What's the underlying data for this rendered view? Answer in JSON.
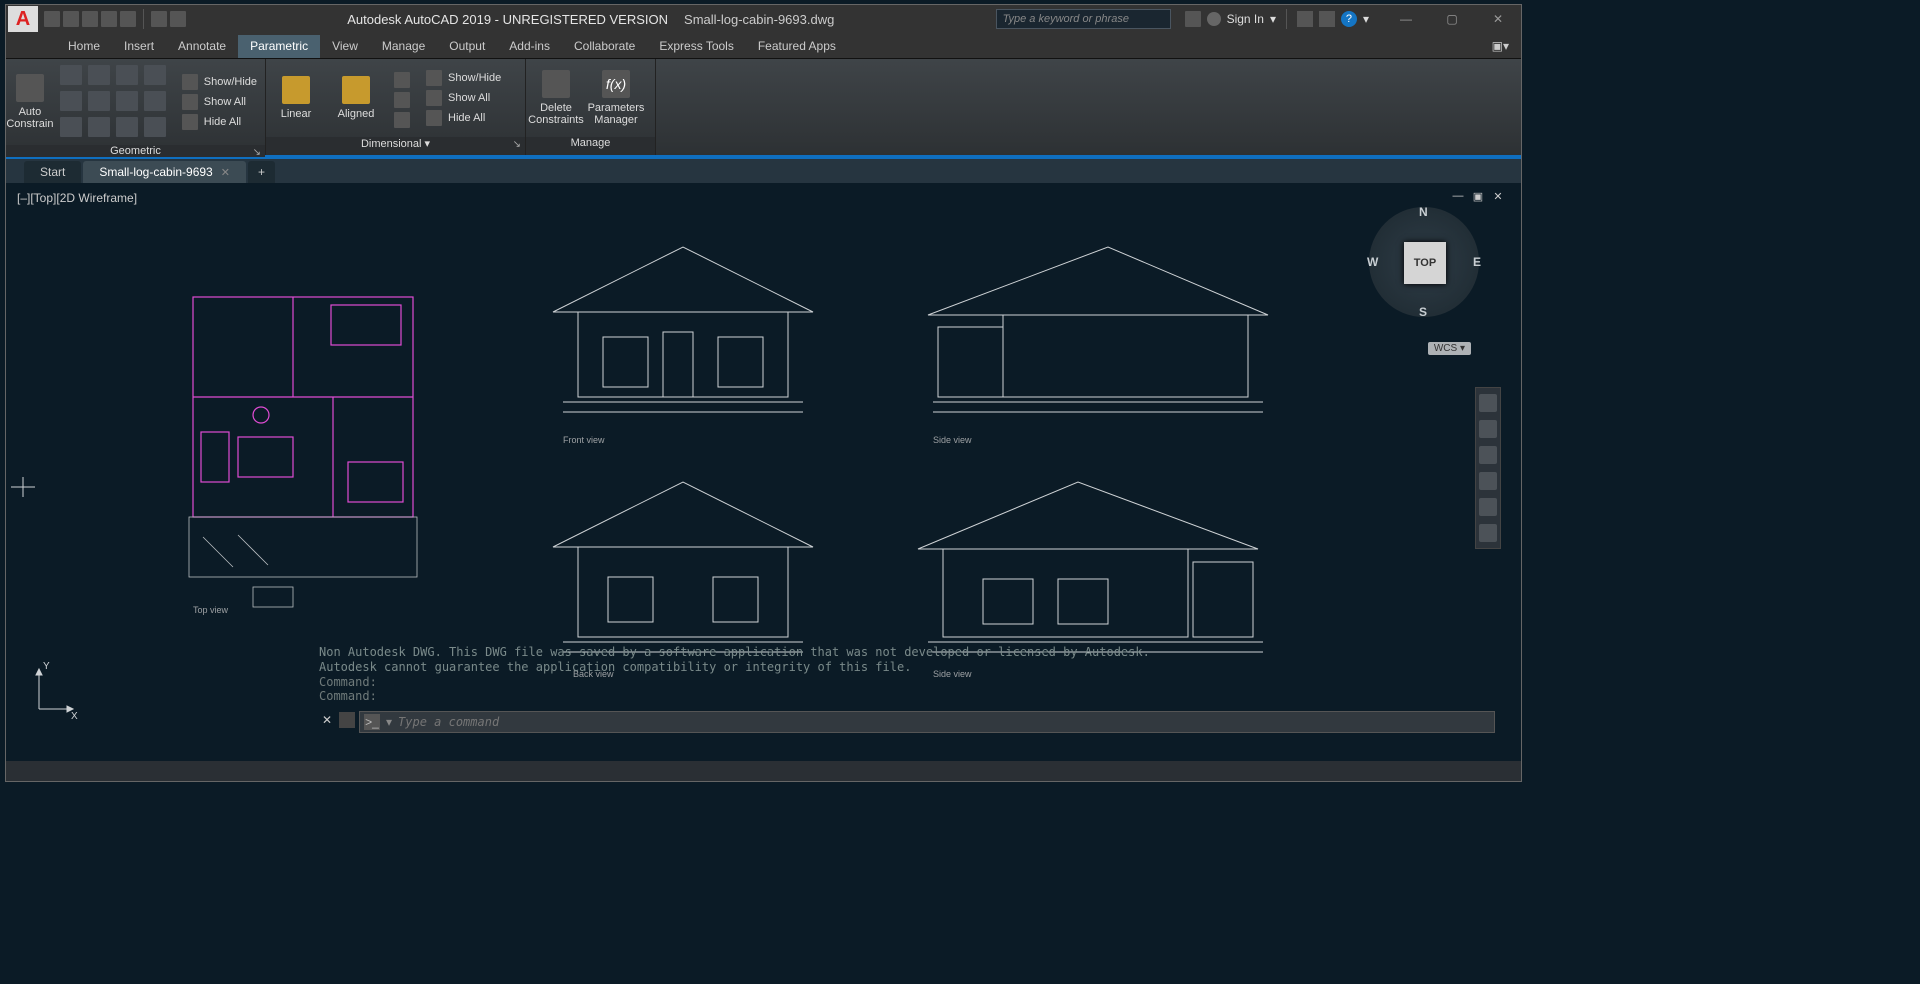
{
  "title": {
    "app": "Autodesk AutoCAD 2019 - UNREGISTERED VERSION",
    "file": "Small-log-cabin-9693.dwg"
  },
  "search": {
    "placeholder": "Type a keyword or phrase"
  },
  "signin": {
    "label": "Sign In"
  },
  "ribbon": {
    "tabs": [
      "Home",
      "Insert",
      "Annotate",
      "Parametric",
      "View",
      "Manage",
      "Output",
      "Add-ins",
      "Collaborate",
      "Express Tools",
      "Featured Apps"
    ],
    "active": "Parametric",
    "panels": {
      "geo": {
        "auto": "Auto\nConstrain",
        "items": [
          "Show/Hide",
          "Show All",
          "Hide All"
        ],
        "label": "Geometric"
      },
      "dim": {
        "linear": "Linear",
        "aligned": "Aligned",
        "items": [
          "Show/Hide",
          "Show All",
          "Hide All"
        ],
        "label": "Dimensional"
      },
      "mgr": {
        "del": "Delete\nConstraints",
        "param": "Parameters\nManager",
        "label": "Manage"
      }
    }
  },
  "filetabs": {
    "start": "Start",
    "doc": "Small-log-cabin-9693"
  },
  "viewport": {
    "label": "[–][Top][2D Wireframe]"
  },
  "viewcube": {
    "face": "TOP",
    "n": "N",
    "s": "S",
    "e": "E",
    "w": "W",
    "wcs": "WCS"
  },
  "drawings": {
    "plan": "Top view",
    "front": "Front view",
    "side1": "Side view",
    "back": "Back view",
    "side2": "Side view"
  },
  "cmd": {
    "msg1": "Non Autodesk DWG.  This DWG file was saved by a software application that was not developed or licensed by Autodesk.",
    "msg2": "Autodesk cannot guarantee the application compatibility or integrity of this file.",
    "prompt1": "Command:",
    "prompt2": "Command:",
    "placeholder": "Type a command"
  },
  "ucs": {
    "x": "X",
    "y": "Y"
  }
}
